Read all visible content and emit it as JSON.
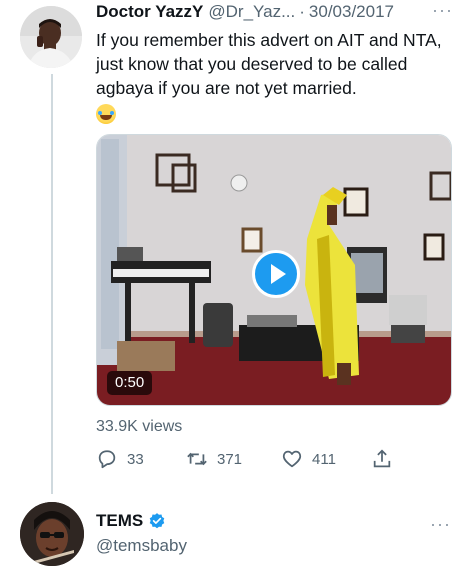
{
  "tweet": {
    "author_name": "Doctor YazzY",
    "handle": "@Dr_Yaz...",
    "separator": "·",
    "date": "30/03/2017",
    "more_icon": "ellipsis-icon",
    "text": "If you remember this advert on AIT and NTA, just know that you deserved to be called agbaya if you are not yet married.",
    "emoji": "tears-of-joy-emoji",
    "video": {
      "duration": "0:50",
      "play_icon": "play-icon"
    },
    "views": "33.9K views",
    "actions": {
      "reply": {
        "icon": "reply-icon",
        "count": "33"
      },
      "retweet": {
        "icon": "retweet-icon",
        "count": "371"
      },
      "like": {
        "icon": "heart-icon",
        "count": "411"
      },
      "share": {
        "icon": "share-icon"
      }
    }
  },
  "reply": {
    "author_name": "TEMS",
    "verified_icon": "verified-badge-icon",
    "handle": "@temsbaby",
    "more_icon": "ellipsis-icon"
  },
  "colors": {
    "accent": "#1d9bf0",
    "secondary_text": "#536471",
    "thread_line": "#cfd9de"
  }
}
